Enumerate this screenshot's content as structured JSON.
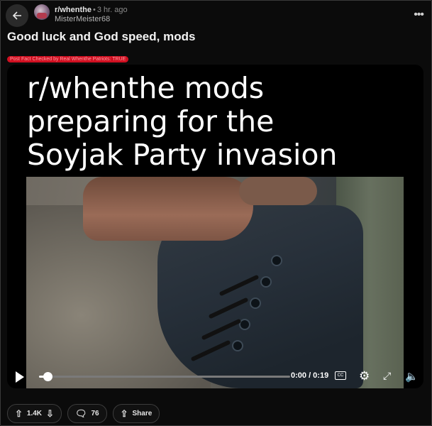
{
  "header": {
    "subreddit": "r/whenthe",
    "time": "3 hr. ago",
    "username": "MisterMeister68"
  },
  "post": {
    "title": "Good luck and God speed, mods",
    "flair": "Post Fact Checked by Real Whenthe Patriots: TRUE"
  },
  "media": {
    "caption_line1": "r/whenthe mods",
    "caption_line2": "preparing for the",
    "caption_line3": "Soyjak Party invasion",
    "time_display": "0:00 / 0:19",
    "progress_fraction": 0.035,
    "cc_label": "CC"
  },
  "actions": {
    "vote_count": "1.4K",
    "comment_count": "76",
    "share_label": "Share"
  },
  "icons": {
    "back": "arrow-left-icon",
    "more": "more-horizontal-icon",
    "upvote": "upvote-arrow-icon",
    "downvote": "downvote-arrow-icon",
    "comment": "comment-bubble-icon",
    "share": "share-icon",
    "play": "play-icon",
    "settings": "gear-icon",
    "fullscreen": "expand-icon",
    "volume": "volume-icon"
  }
}
